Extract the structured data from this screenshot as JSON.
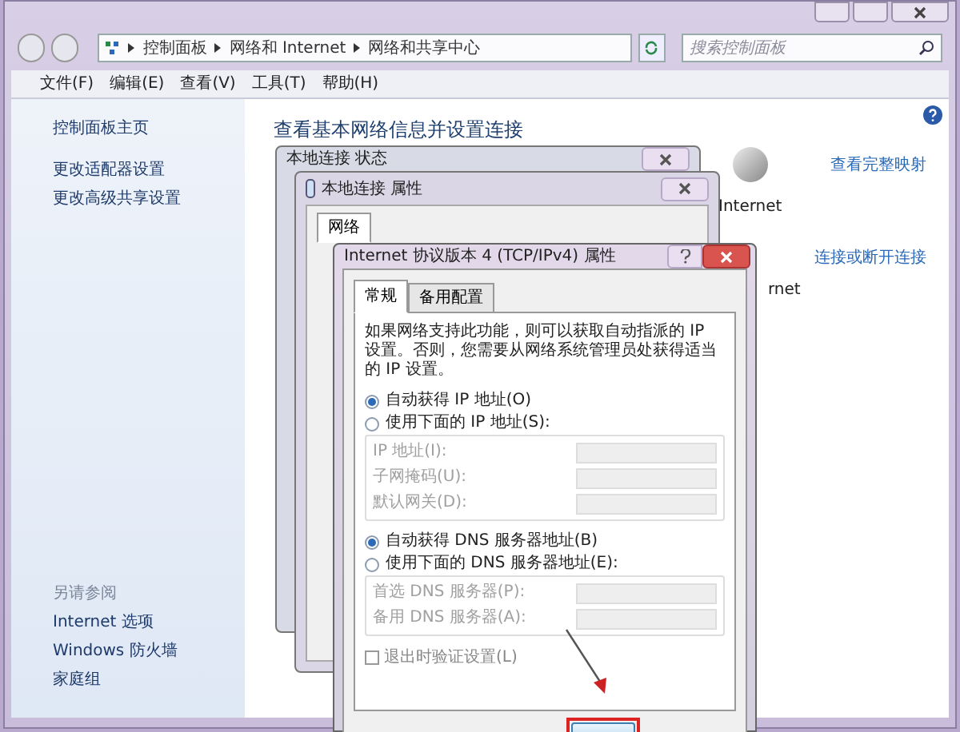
{
  "explorer": {
    "breadcrumb": [
      "控制面板",
      "网络和 Internet",
      "网络和共享中心"
    ],
    "search": {
      "placeholder": "搜索控制面板"
    },
    "menu": [
      "文件(F)",
      "编辑(E)",
      "查看(V)",
      "工具(T)",
      "帮助(H)"
    ]
  },
  "sidebar": {
    "items": [
      "控制面板主页",
      "更改适配器设置",
      "更改高级共享设置"
    ],
    "see_also_title": "另请参阅",
    "see_also": [
      "Internet 选项",
      "Windows 防火墙",
      "家庭组"
    ]
  },
  "main": {
    "title": "查看基本网络信息并设置连接",
    "map_link": "查看完整映射",
    "internet_label": "Internet",
    "connect_link": "连接或断开连接",
    "partial_label": "rnet"
  },
  "status_dialog": {
    "title": "本地连接 状态"
  },
  "properties_dialog": {
    "title": "本地连接 属性",
    "tabs": [
      {
        "label": "网络",
        "selected": true
      }
    ]
  },
  "ipv4_dialog": {
    "title": "Internet 协议版本 4 (TCP/IPv4) 属性",
    "tabs": [
      {
        "label": "常规",
        "selected": true
      },
      {
        "label": "备用配置",
        "selected": false
      }
    ],
    "description": "如果网络支持此功能，则可以获取自动指派的 IP 设置。否则，您需要从网络系统管理员处获得适当的 IP 设置。",
    "ip_options": [
      {
        "label": "自动获得 IP 地址(O)",
        "selected": true
      },
      {
        "label": "使用下面的 IP 地址(S):",
        "selected": false
      }
    ],
    "ip_fields": [
      {
        "label": "IP 地址(I):",
        "disabled": true
      },
      {
        "label": "子网掩码(U):",
        "disabled": true
      },
      {
        "label": "默认网关(D):",
        "disabled": true
      }
    ],
    "dns_options": [
      {
        "label": "自动获得 DNS 服务器地址(B)",
        "selected": true
      },
      {
        "label": "使用下面的 DNS 服务器地址(E):",
        "selected": false
      }
    ],
    "dns_fields": [
      {
        "label": "首选 DNS 服务器(P):",
        "disabled": true
      },
      {
        "label": "备用 DNS 服务器(A):",
        "disabled": true
      }
    ],
    "validate": {
      "label": "退出时验证设置(L)",
      "checked": false
    }
  }
}
